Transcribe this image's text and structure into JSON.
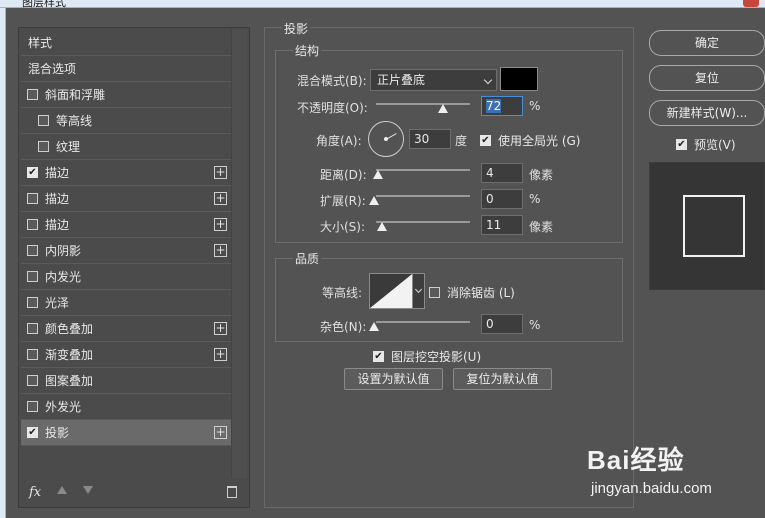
{
  "window": {
    "title": "图层样式"
  },
  "styles_panel": {
    "items": [
      {
        "label": "样式",
        "type": "header"
      },
      {
        "label": "混合选项",
        "type": "header"
      },
      {
        "label": "斜面和浮雕",
        "checked": false,
        "indent": false,
        "plus": false
      },
      {
        "label": "等高线",
        "checked": false,
        "indent": true,
        "plus": false
      },
      {
        "label": "纹理",
        "checked": false,
        "indent": true,
        "plus": false
      },
      {
        "label": "描边",
        "checked": true,
        "indent": false,
        "plus": true
      },
      {
        "label": "描边",
        "checked": false,
        "indent": false,
        "plus": true
      },
      {
        "label": "描边",
        "checked": false,
        "indent": false,
        "plus": true
      },
      {
        "label": "内阴影",
        "checked": false,
        "indent": false,
        "plus": true
      },
      {
        "label": "内发光",
        "checked": false,
        "indent": false,
        "plus": false
      },
      {
        "label": "光泽",
        "checked": false,
        "indent": false,
        "plus": false
      },
      {
        "label": "颜色叠加",
        "checked": false,
        "indent": false,
        "plus": true
      },
      {
        "label": "渐变叠加",
        "checked": false,
        "indent": false,
        "plus": true
      },
      {
        "label": "图案叠加",
        "checked": false,
        "indent": false,
        "plus": false
      },
      {
        "label": "外发光",
        "checked": false,
        "indent": false,
        "plus": false
      },
      {
        "label": "投影",
        "checked": true,
        "indent": false,
        "plus": true,
        "selected": true
      }
    ],
    "footer": {
      "fx_label": "fx"
    }
  },
  "drop_shadow": {
    "title": "投影",
    "structure": {
      "title": "结构",
      "blend_mode_label": "混合模式(B):",
      "blend_mode_value": "正片叠底",
      "shadow_color": "#000000",
      "opacity_label": "不透明度(O):",
      "opacity_value": "72",
      "opacity_unit": "%",
      "angle_label": "角度(A):",
      "angle_value": "30",
      "angle_unit": "度",
      "global_light_label": "使用全局光 (G)",
      "global_light_checked": true,
      "distance_label": "距离(D):",
      "distance_value": "4",
      "distance_unit": "像素",
      "spread_label": "扩展(R):",
      "spread_value": "0",
      "spread_unit": "%",
      "size_label": "大小(S):",
      "size_value": "11",
      "size_unit": "像素"
    },
    "quality": {
      "title": "品质",
      "contour_label": "等高线:",
      "antialias_label": "消除锯齿 (L)",
      "antialias_checked": false,
      "noise_label": "杂色(N):",
      "noise_value": "0",
      "noise_unit": "%"
    },
    "knockout_label": "图层挖空投影(U)",
    "knockout_checked": true,
    "set_default_label": "设置为默认值",
    "reset_default_label": "复位为默认值"
  },
  "actions": {
    "ok_label": "确定",
    "reset_label": "复位",
    "new_style_label": "新建样式(W)...",
    "preview_label": "预览(V)",
    "preview_checked": true
  },
  "watermark": {
    "brand": "Bai经验",
    "url": "jingyan.baidu.com"
  }
}
